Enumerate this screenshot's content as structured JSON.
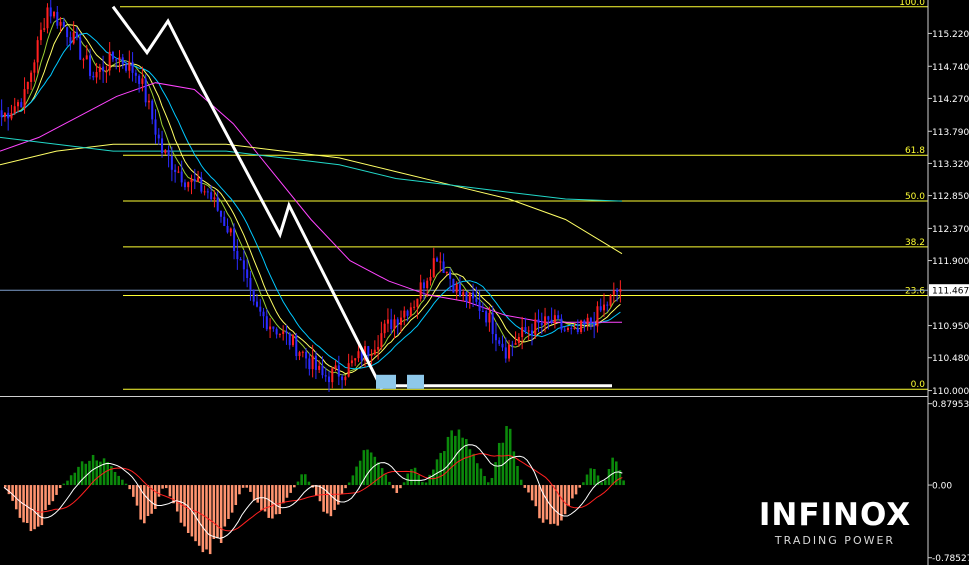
{
  "chart_data": [
    {
      "type": "candlestick",
      "title": "",
      "y_axis_labels": [
        "115.220",
        "114.740",
        "114.270",
        "113.790",
        "113.320",
        "112.850",
        "112.370",
        "111.900",
        "110.950",
        "110.480",
        "110.000"
      ],
      "ylim": [
        109.95,
        115.65
      ],
      "current_price": "111.467",
      "current_price_value": 111.467,
      "colors": {
        "up": "#ff2020",
        "down": "#2b2bff",
        "background": "#000000",
        "fib": "#ffff33",
        "current_price_line": "#7e9ecc",
        "zigzag": "#ffffff",
        "ma_fast": "#00c8ff",
        "ma_medium": "#ffff66",
        "ma_slow": "#ff44ff",
        "ma_long": "#ffff66",
        "ma_longest": "#22d8c8"
      },
      "fibonacci": [
        {
          "label": "100.0",
          "price": 115.61
        },
        {
          "label": "61.8",
          "price": 113.44
        },
        {
          "label": "50.0",
          "price": 112.77
        },
        {
          "label": "38.2",
          "price": 112.1
        },
        {
          "label": "23.6",
          "price": 111.39
        },
        {
          "label": "0.0",
          "price": 110.02
        }
      ],
      "zigzag_prices": [
        115.61,
        114.94,
        115.4,
        114.48,
        112.28,
        112.71,
        110.02
      ],
      "support_line_price": 110.07,
      "series_shape": [
        114.0,
        114.3,
        115.6,
        115.2,
        114.6,
        114.9,
        114.6,
        113.5,
        113.1,
        112.9,
        112.3,
        111.2,
        110.9,
        110.6,
        110.2,
        110.3,
        110.6,
        111.0,
        111.3,
        112.0,
        111.4,
        111.2,
        110.6,
        110.9,
        111.0,
        110.8,
        111.1,
        111.5
      ],
      "moving_averages": [
        {
          "key": "ma_slow",
          "values": [
            113.5,
            113.7,
            114.0,
            114.3,
            114.5,
            114.4,
            113.9,
            113.2,
            112.5,
            111.9,
            111.6,
            111.4,
            111.3,
            111.1,
            111.0,
            111.0,
            111.0
          ]
        },
        {
          "key": "ma_long",
          "values": [
            113.3,
            113.5,
            113.6,
            113.6,
            113.6,
            113.5,
            113.4,
            113.2,
            113.0,
            112.8,
            112.5,
            112.0
          ]
        },
        {
          "key": "ma_longest",
          "values": [
            113.7,
            113.6,
            113.5,
            113.5,
            113.5,
            113.4,
            113.3,
            113.1,
            113.0,
            112.9,
            112.8,
            112.77
          ]
        }
      ]
    },
    {
      "type": "histogram",
      "y_axis_labels": [
        "0.87953",
        "0.00",
        "-0.78527"
      ],
      "ylim": [
        -0.81,
        0.93
      ],
      "colors": {
        "positive": "#0b8a0b",
        "negative": "#ff9470",
        "signal_a": "#ffffff",
        "signal_b": "#ff2020"
      },
      "segments": [
        {
          "sign": -1,
          "peak": 0.45,
          "length": 16
        },
        {
          "sign": 1,
          "peak": 0.3,
          "length": 18
        },
        {
          "sign": -1,
          "peak": 0.4,
          "length": 10
        },
        {
          "sign": -1,
          "peak": 0.75,
          "length": 22
        },
        {
          "sign": -1,
          "peak": 0.35,
          "length": 14
        },
        {
          "sign": 1,
          "peak": 0.12,
          "length": 4
        },
        {
          "sign": -1,
          "peak": 0.3,
          "length": 10
        },
        {
          "sign": 1,
          "peak": 0.38,
          "length": 12
        },
        {
          "sign": -1,
          "peak": 0.08,
          "length": 3
        },
        {
          "sign": 1,
          "peak": 0.18,
          "length": 6
        },
        {
          "sign": 1,
          "peak": 0.55,
          "length": 18
        },
        {
          "sign": 1,
          "peak": 0.58,
          "length": 9
        },
        {
          "sign": -1,
          "peak": 0.45,
          "length": 16
        },
        {
          "sign": 1,
          "peak": 0.18,
          "length": 6
        },
        {
          "sign": 1,
          "peak": 0.3,
          "length": 6
        }
      ]
    }
  ],
  "branding": {
    "name": "INFINOX",
    "tagline": "TRADING POWER"
  }
}
